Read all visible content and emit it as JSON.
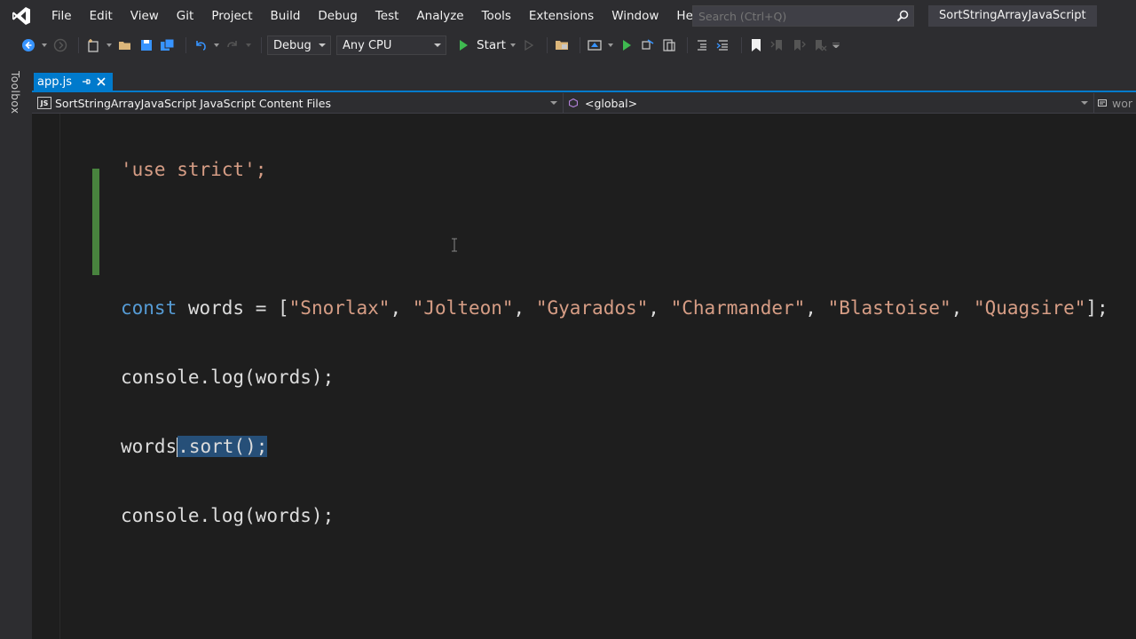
{
  "menubar": {
    "items": [
      "File",
      "Edit",
      "View",
      "Git",
      "Project",
      "Build",
      "Debug",
      "Test",
      "Analyze",
      "Tools",
      "Extensions",
      "Window",
      "Help"
    ],
    "search_placeholder": "Search (Ctrl+Q)",
    "solution_name": "SortStringArrayJavaScript"
  },
  "toolbar": {
    "configuration": "Debug",
    "platform": "Any CPU",
    "start_label": "Start"
  },
  "side": {
    "toolbox_label": "Toolbox"
  },
  "tabs": {
    "active_file": "app.js"
  },
  "navbar": {
    "project": "SortStringArrayJavaScript JavaScript Content Files",
    "scope": "<global>",
    "member": "wor"
  },
  "editor": {
    "line1": "'use strict';",
    "line3_kw": "const",
    "line3_rest_a": " words = [",
    "line3_strings": [
      "\"Snorlax\"",
      "\"Jolteon\"",
      "\"Gyarados\"",
      "\"Charmander\"",
      "\"Blastoise\"",
      "\"Quagsire\""
    ],
    "line3_end": "];",
    "line4": "console.log(words);",
    "line5_a": "words",
    "line5_sel": ".sort();",
    "line6": "console.log(words);"
  },
  "colors": {
    "accent": "#007acc",
    "keyword": "#569cd6",
    "string": "#d69d85",
    "change_bar": "#57a64a"
  }
}
